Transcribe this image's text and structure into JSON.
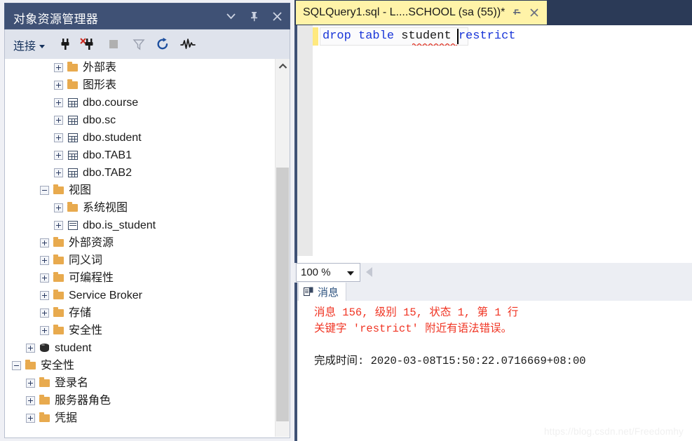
{
  "object_explorer": {
    "title": "对象资源管理器",
    "title_buttons": [
      {
        "name": "dropdown-icon",
        "glyph": "▼"
      },
      {
        "name": "pin-icon",
        "glyph": "pin"
      },
      {
        "name": "close-icon",
        "glyph": "✕"
      }
    ],
    "toolbar": {
      "connect_label": "连接",
      "icons": [
        "connect-plug-icon",
        "disconnect-plug-icon",
        "stop-icon",
        "filter-icon",
        "refresh-icon",
        "activity-monitor-icon"
      ]
    },
    "scroll": {
      "position_percent": 29
    },
    "tree": [
      {
        "label": "外部表",
        "icon": "folder",
        "indent": 3,
        "state": "collapsed"
      },
      {
        "label": "图形表",
        "icon": "folder",
        "indent": 3,
        "state": "collapsed"
      },
      {
        "label": "dbo.course",
        "icon": "table",
        "indent": 3,
        "state": "collapsed"
      },
      {
        "label": "dbo.sc",
        "icon": "table",
        "indent": 3,
        "state": "collapsed"
      },
      {
        "label": "dbo.student",
        "icon": "table",
        "indent": 3,
        "state": "collapsed"
      },
      {
        "label": "dbo.TAB1",
        "icon": "table",
        "indent": 3,
        "state": "collapsed"
      },
      {
        "label": "dbo.TAB2",
        "icon": "table",
        "indent": 3,
        "state": "collapsed"
      },
      {
        "label": "视图",
        "icon": "folder",
        "indent": 2,
        "state": "expanded"
      },
      {
        "label": "系统视图",
        "icon": "folder",
        "indent": 3,
        "state": "collapsed"
      },
      {
        "label": "dbo.is_student",
        "icon": "view",
        "indent": 3,
        "state": "collapsed"
      },
      {
        "label": "外部资源",
        "icon": "folder",
        "indent": 2,
        "state": "collapsed"
      },
      {
        "label": "同义词",
        "icon": "folder",
        "indent": 2,
        "state": "collapsed"
      },
      {
        "label": "可编程性",
        "icon": "folder",
        "indent": 2,
        "state": "collapsed"
      },
      {
        "label": "Service Broker",
        "icon": "folder",
        "indent": 2,
        "state": "collapsed"
      },
      {
        "label": "存储",
        "icon": "folder",
        "indent": 2,
        "state": "collapsed"
      },
      {
        "label": "安全性",
        "icon": "folder",
        "indent": 2,
        "state": "collapsed"
      },
      {
        "label": "student",
        "icon": "database",
        "indent": 1,
        "state": "collapsed"
      },
      {
        "label": "安全性",
        "icon": "folder",
        "indent": 0,
        "state": "expanded"
      },
      {
        "label": "登录名",
        "icon": "folder",
        "indent": 1,
        "state": "collapsed"
      },
      {
        "label": "服务器角色",
        "icon": "folder",
        "indent": 1,
        "state": "collapsed"
      },
      {
        "label": "凭据",
        "icon": "folder",
        "indent": 1,
        "state": "collapsed"
      }
    ]
  },
  "editor": {
    "tab_title": "SQLQuery1.sql - L....SCHOOL (sa (55))*",
    "tab_buttons": [
      {
        "name": "pin-icon",
        "glyph": "pin"
      },
      {
        "name": "close-icon",
        "glyph": "✕"
      }
    ],
    "code": {
      "keyword1": "drop",
      "keyword2": "table",
      "identifier": "student",
      "error_token": "restrict",
      "full_text": "drop table student restrict"
    }
  },
  "results": {
    "zoom_value": "100 %",
    "tab_label": "消息",
    "tab_icon": "messages-icon",
    "message_error_line1": "消息 156, 级别 15, 状态 1, 第 1 行",
    "message_error_line2": "关键字 'restrict' 附近有语法错误。",
    "completion_line": "完成时间: 2020-03-08T15:50:22.0716669+08:00"
  },
  "watermark": "https://blog.csdn.net/Freedomhy",
  "colors": {
    "panel_title_bg": "#3f5175",
    "tabstrip_bg": "#2b3a57",
    "active_tab_bg": "#fff3a8",
    "keyword": "#1835d8",
    "error_text": "#f03423",
    "folder": "#e8aa4e"
  }
}
